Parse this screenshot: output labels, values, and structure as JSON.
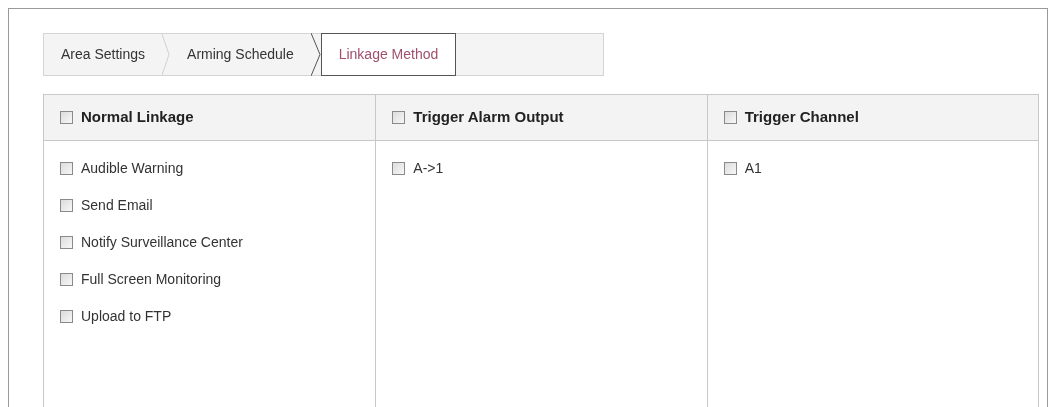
{
  "tabs": [
    {
      "label": "Area Settings",
      "selected": false
    },
    {
      "label": "Arming Schedule",
      "selected": false
    },
    {
      "label": "Linkage Method",
      "selected": true
    }
  ],
  "columns": [
    {
      "header": "Normal Linkage",
      "checked": false,
      "items": [
        {
          "label": "Audible Warning",
          "checked": false
        },
        {
          "label": "Send Email",
          "checked": false
        },
        {
          "label": "Notify Surveillance Center",
          "checked": false
        },
        {
          "label": "Full Screen Monitoring",
          "checked": false
        },
        {
          "label": "Upload to FTP",
          "checked": false
        }
      ]
    },
    {
      "header": "Trigger Alarm Output",
      "checked": false,
      "items": [
        {
          "label": "A->1",
          "checked": false
        }
      ]
    },
    {
      "header": "Trigger Channel",
      "checked": false,
      "items": [
        {
          "label": "A1",
          "checked": false
        }
      ]
    }
  ]
}
